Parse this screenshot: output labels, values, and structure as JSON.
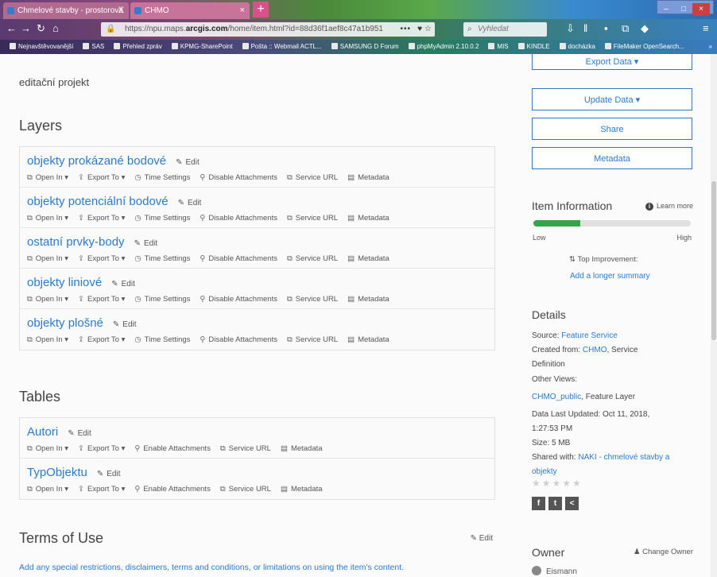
{
  "browser": {
    "tabs": [
      {
        "title": "Chmelové stavby - prostorová",
        "close": "X"
      },
      {
        "title": "CHMO",
        "close": "×"
      }
    ],
    "new_tab": "+",
    "url_prefix": "https://npu.maps.",
    "url_domain": "arcgis.com",
    "url_path": "/home/item.html?id=88d36f1aef8c47a1b951",
    "url_more": "•••",
    "search_placeholder": "Vyhledat",
    "bookmarks": [
      "Nejnavštěvovanější",
      "SAS",
      "Přehled zpráv",
      "KPMG-SharePoint",
      "Pošta :: Webmail ACTL...",
      "SAMSUNG D Forum",
      "phpMyAdmin 2.10.0.2",
      "MIS",
      "KINDLE",
      "docházka",
      "FileMaker OpenSearch..."
    ],
    "bookmarks_more": "»"
  },
  "main": {
    "intro": "editační projekt",
    "layers_title": "Layers",
    "layers": [
      {
        "name": "objekty prokázané bodové",
        "edit": "Edit"
      },
      {
        "name": "objekty potenciální bodové",
        "edit": "Edit"
      },
      {
        "name": "ostatní prvky-body",
        "edit": "Edit"
      },
      {
        "name": "objekty liniové",
        "edit": "Edit"
      },
      {
        "name": "objekty plošné",
        "edit": "Edit"
      }
    ],
    "layer_actions": {
      "open_in": "Open In ▾",
      "export_to": "Export To ▾",
      "time_settings": "Time Settings",
      "disable_attachments": "Disable Attachments",
      "service_url": "Service URL",
      "metadata": "Metadata"
    },
    "tables_title": "Tables",
    "tables": [
      {
        "name": "Autori",
        "edit": "Edit"
      },
      {
        "name": "TypObjektu",
        "edit": "Edit"
      }
    ],
    "table_actions": {
      "open_in": "Open In ▾",
      "export_to": "Export To ▾",
      "enable_attachments": "Enable Attachments",
      "service_url": "Service URL",
      "metadata": "Metadata"
    },
    "terms_title": "Terms of Use",
    "terms_edit": "Edit",
    "terms_text": "Add any special restrictions, disclaimers, terms and conditions, or limitations on using the item's content."
  },
  "sidebar": {
    "buttons": {
      "export": "Export Data ▾",
      "update": "Update Data ▾",
      "share": "Share",
      "metadata": "Metadata"
    },
    "item_info_title": "Item Information",
    "learn_more": "Learn more",
    "progress_fraction": 0.3,
    "low": "Low",
    "high": "High",
    "top_improvement": "Top Improvement:",
    "add_summary": "Add a longer summary",
    "details_title": "Details",
    "source_label": "Source:",
    "source_value": "Feature Service",
    "created_label": "Created from:",
    "created_link": "CHMO",
    "created_rest": ", Service",
    "created_rest2": "Definition",
    "other_views_label": "Other Views:",
    "other_views_link": "CHMO_public",
    "other_views_rest": ", Feature Layer",
    "updated_label": "Data Last Updated: Oct 11, 2018,",
    "updated_time": "1:27:53 PM",
    "size": "Size: 5 MB",
    "shared_label": "Shared with:",
    "shared_link": "NAKI - chmelové stavby a",
    "shared_link2": "objekty",
    "rating_stars": "★★★★★",
    "social": [
      "f",
      "t",
      "<"
    ],
    "owner_title": "Owner",
    "change_owner": "Change Owner",
    "owner_name": "Eismann"
  }
}
